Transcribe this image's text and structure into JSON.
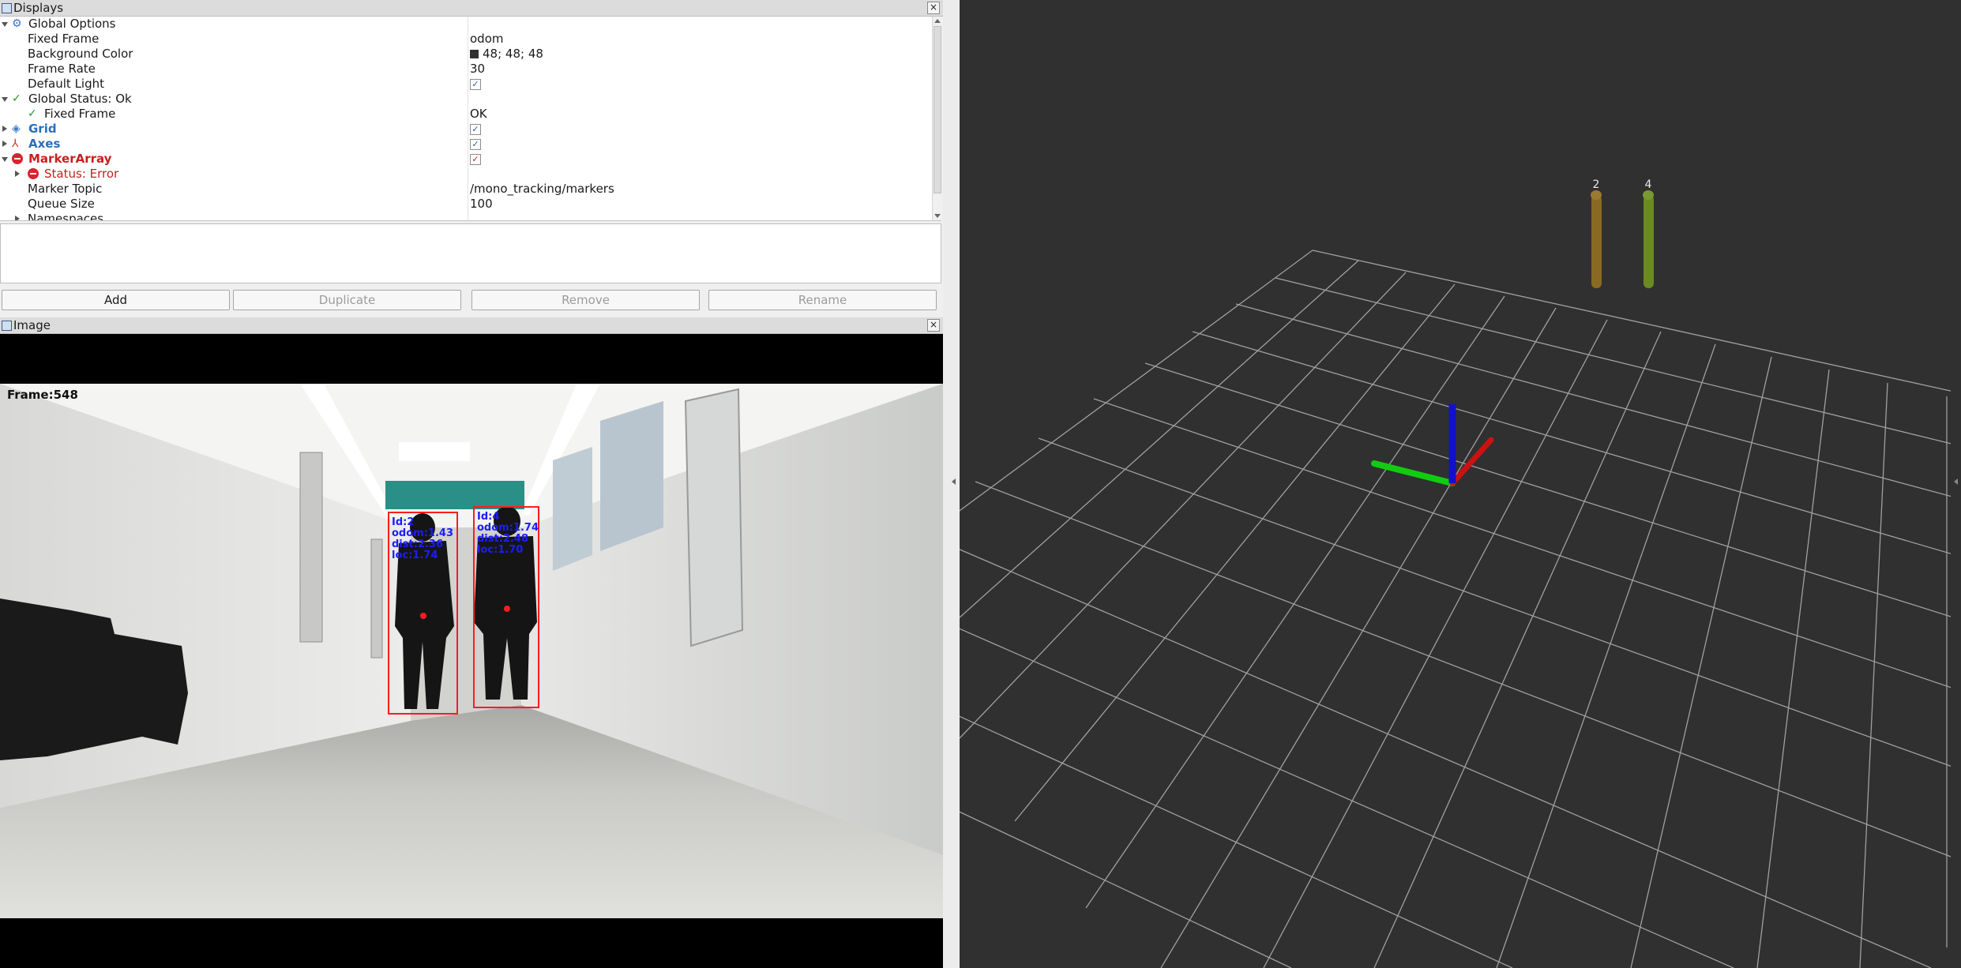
{
  "displays_panel": {
    "title": "Displays",
    "close": "×",
    "rows": [
      {
        "name": "Global Options",
        "value": ""
      },
      {
        "name": "Fixed Frame",
        "value": "odom"
      },
      {
        "name": "Background Color",
        "value": "48; 48; 48"
      },
      {
        "name": "Frame Rate",
        "value": "30"
      },
      {
        "name": "Default Light",
        "value": "✓"
      },
      {
        "name": "Global Status: Ok",
        "value": ""
      },
      {
        "name": "Fixed Frame",
        "value": "OK"
      },
      {
        "name": "Grid",
        "value": "✓"
      },
      {
        "name": "Axes",
        "value": "✓"
      },
      {
        "name": "MarkerArray",
        "value": "✓"
      },
      {
        "name": "Status: Error",
        "value": ""
      },
      {
        "name": "Marker Topic",
        "value": "/mono_tracking/markers"
      },
      {
        "name": "Queue Size",
        "value": "100"
      },
      {
        "name": "Namespaces",
        "value": ""
      }
    ],
    "buttons": {
      "add": "Add",
      "duplicate": "Duplicate",
      "remove": "Remove",
      "rename": "Rename"
    }
  },
  "image_panel": {
    "title": "Image",
    "close": "×",
    "frame_label": "Frame:548",
    "overlays": [
      {
        "id": "Id:2",
        "lines": [
          "odom:1.43",
          "dist:2.36",
          "loc:1.74"
        ]
      },
      {
        "id": "Id:4",
        "lines": [
          "odom:1.74",
          "dist:2.48",
          "loc:1.70"
        ]
      }
    ]
  },
  "viewport": {
    "background": "#303030",
    "markers": [
      {
        "label": "2",
        "color": "#8a6a22"
      },
      {
        "label": "4",
        "color": "#6a8a22"
      }
    ],
    "axes_colors": {
      "x": "#cc1111",
      "y": "#11cc11",
      "z": "#1111cc"
    }
  }
}
